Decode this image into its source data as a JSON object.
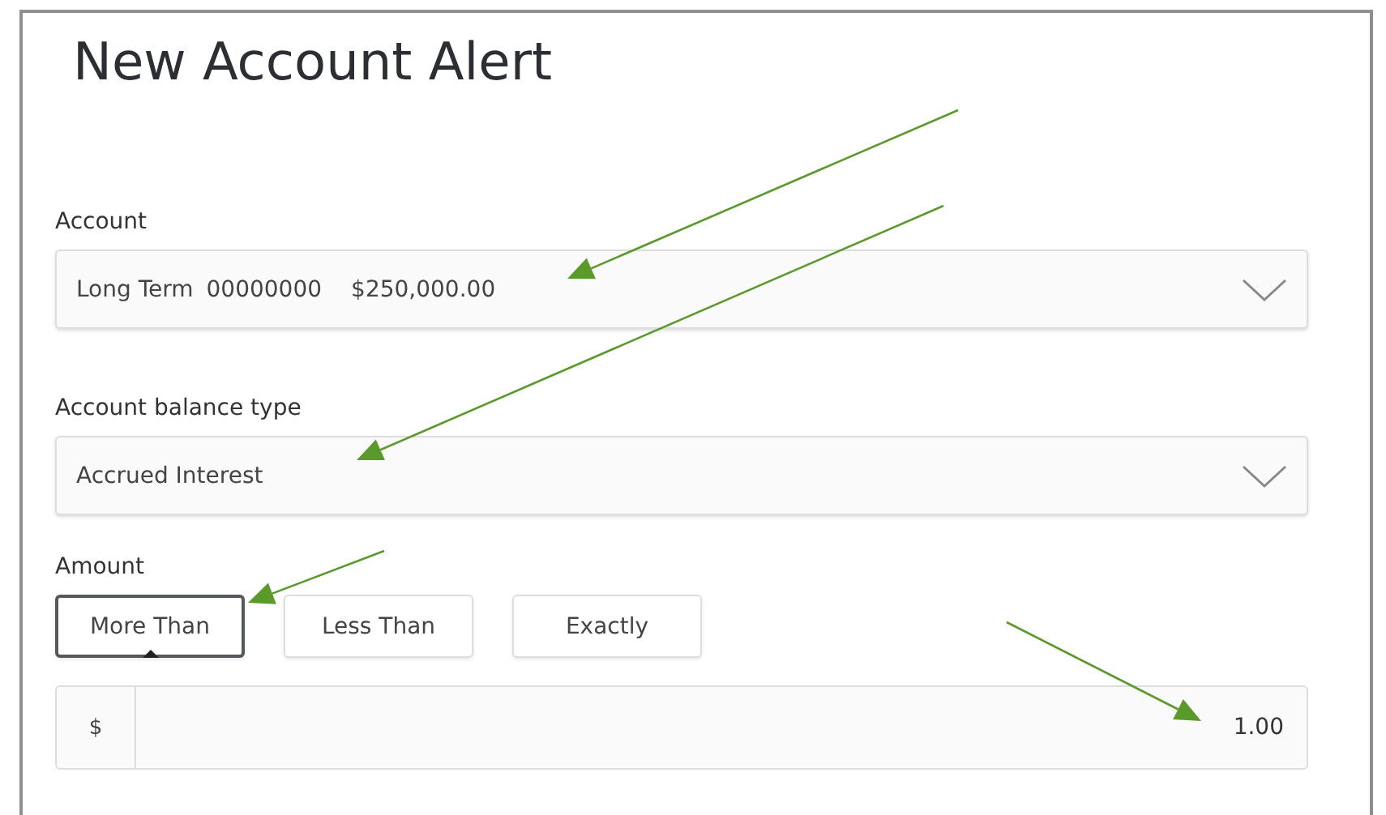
{
  "title": "New Account Alert",
  "account": {
    "label": "Account",
    "parts": [
      "Long Term",
      "00000000",
      "$250,000.00"
    ]
  },
  "balance_type": {
    "label": "Account balance type",
    "value": "Accrued Interest"
  },
  "amount": {
    "label": "Amount",
    "options": [
      {
        "label": "More Than",
        "selected": true
      },
      {
        "label": "Less Than",
        "selected": false
      },
      {
        "label": "Exactly",
        "selected": false
      }
    ],
    "prefix": "$",
    "value": "1.00"
  }
}
